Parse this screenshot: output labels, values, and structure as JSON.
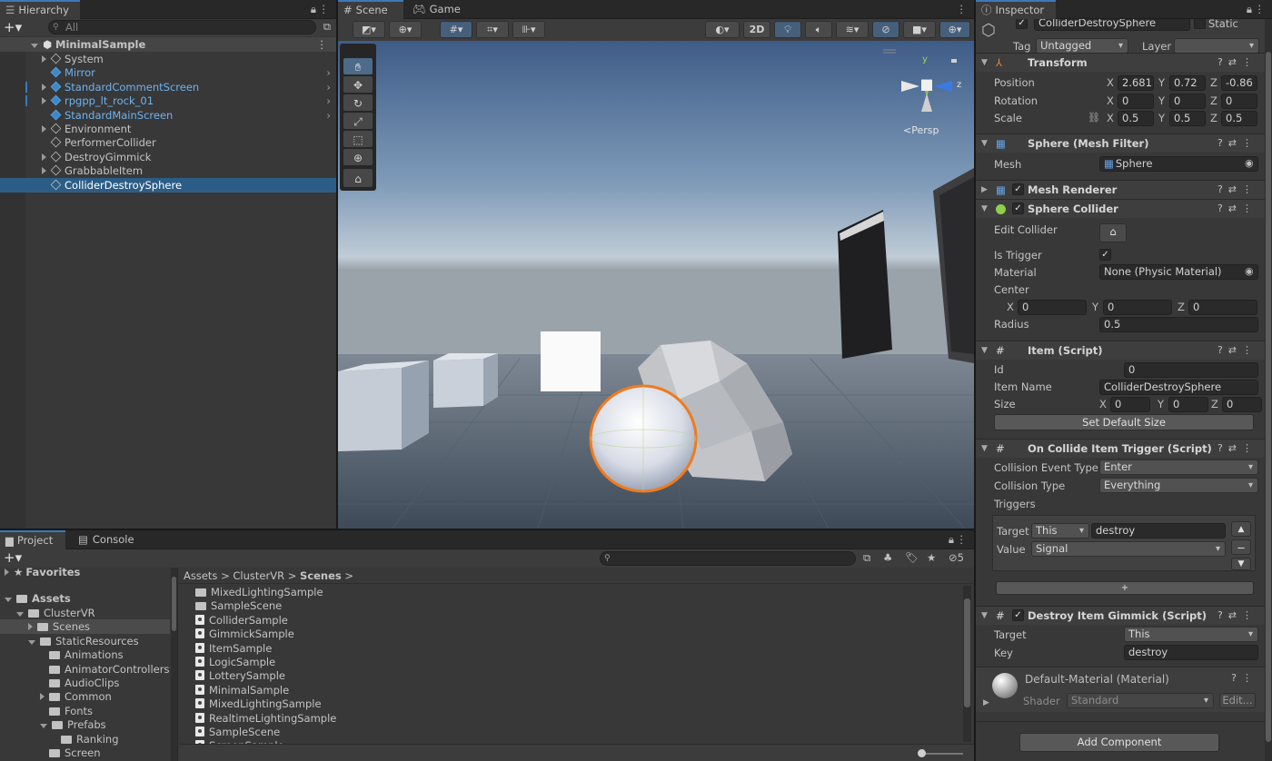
{
  "hierarchy": {
    "tab": "Hierarchy",
    "search_placeholder": "All",
    "root": "MinimalSample",
    "items": [
      {
        "label": "System",
        "blue": false,
        "expand": true,
        "arrow": false
      },
      {
        "label": "Mirror",
        "blue": true,
        "expand": false,
        "arrow": true
      },
      {
        "label": "StandardCommentScreen",
        "blue": true,
        "expand": true,
        "arrow": true
      },
      {
        "label": "rpgpp_lt_rock_01",
        "blue": true,
        "expand": true,
        "arrow": true
      },
      {
        "label": "StandardMainScreen",
        "blue": true,
        "expand": false,
        "arrow": true
      },
      {
        "label": "Environment",
        "blue": false,
        "expand": true,
        "arrow": false
      },
      {
        "label": "PerformerCollider",
        "blue": false,
        "expand": false,
        "arrow": false
      },
      {
        "label": "DestroyGimmick",
        "blue": false,
        "expand": true,
        "arrow": false
      },
      {
        "label": "GrabbableItem",
        "blue": false,
        "expand": true,
        "arrow": false
      },
      {
        "label": "ColliderDestroySphere",
        "blue": false,
        "expand": false,
        "arrow": false,
        "selected": true
      }
    ]
  },
  "scene": {
    "tab_scene": "Scene",
    "tab_game": "Game",
    "btn_2d": "2D",
    "persp": "Persp",
    "axis_y": "y",
    "axis_z": "z"
  },
  "project": {
    "tab_project": "Project",
    "tab_console": "Console",
    "favorites": "Favorites",
    "assets": "Assets",
    "hidden_count": "5",
    "breadcrumb": [
      "Assets",
      "ClusterVR",
      "Scenes"
    ],
    "tree": [
      {
        "label": "ClusterVR",
        "indent": 1,
        "open": true
      },
      {
        "label": "Scenes",
        "indent": 2,
        "open": false,
        "selected": true
      },
      {
        "label": "StaticResources",
        "indent": 2,
        "open": true
      },
      {
        "label": "Animations",
        "indent": 3,
        "open": false,
        "noarrow": true
      },
      {
        "label": "AnimatorControllers",
        "indent": 3,
        "open": false,
        "noarrow": true
      },
      {
        "label": "AudioClips",
        "indent": 3,
        "open": false,
        "noarrow": true
      },
      {
        "label": "Common",
        "indent": 3,
        "open": false
      },
      {
        "label": "Fonts",
        "indent": 3,
        "open": false,
        "noarrow": true
      },
      {
        "label": "Prefabs",
        "indent": 3,
        "open": true
      },
      {
        "label": "Ranking",
        "indent": 4,
        "open": false,
        "noarrow": true
      },
      {
        "label": "Screen",
        "indent": 3,
        "open": false,
        "noarrow": true
      }
    ],
    "files": [
      {
        "label": "MixedLightingSample",
        "type": "folder"
      },
      {
        "label": "SampleScene",
        "type": "folder"
      },
      {
        "label": "ColliderSample",
        "type": "scene"
      },
      {
        "label": "GimmickSample",
        "type": "scene"
      },
      {
        "label": "ItemSample",
        "type": "scene"
      },
      {
        "label": "LogicSample",
        "type": "scene"
      },
      {
        "label": "LotterySample",
        "type": "scene"
      },
      {
        "label": "MinimalSample",
        "type": "scene"
      },
      {
        "label": "MixedLightingSample",
        "type": "scene"
      },
      {
        "label": "RealtimeLightingSample",
        "type": "scene"
      },
      {
        "label": "SampleScene",
        "type": "scene"
      },
      {
        "label": "ScreenSample",
        "type": "scene"
      }
    ]
  },
  "inspector": {
    "tab": "Inspector",
    "object_name": "ColliderDestroySphere",
    "static_label": "Static",
    "tag_label": "Tag",
    "tag_value": "Untagged",
    "layer_label": "Layer",
    "layer_value": "",
    "transform": {
      "title": "Transform",
      "position_label": "Position",
      "rotation_label": "Rotation",
      "scale_label": "Scale",
      "position": [
        "2.681",
        "0.72",
        "-0.86"
      ],
      "rotation": [
        "0",
        "0",
        "0"
      ],
      "scale": [
        "0.5",
        "0.5",
        "0.5"
      ]
    },
    "mesh_filter": {
      "title": "Sphere (Mesh Filter)",
      "mesh_label": "Mesh",
      "mesh_value": "Sphere"
    },
    "mesh_renderer": {
      "title": "Mesh Renderer"
    },
    "sphere_collider": {
      "title": "Sphere Collider",
      "edit_label": "Edit Collider",
      "trigger_label": "Is Trigger",
      "material_label": "Material",
      "material_value": "None (Physic Material)",
      "center_label": "Center",
      "center": [
        "0",
        "0",
        "0"
      ],
      "radius_label": "Radius",
      "radius_value": "0.5"
    },
    "item_script": {
      "title": "Item (Script)",
      "id_label": "Id",
      "id_value": "0",
      "name_label": "Item Name",
      "name_value": "ColliderDestroySphere",
      "size_label": "Size",
      "size": [
        "0",
        "0",
        "0"
      ],
      "default_btn": "Set Default Size"
    },
    "trigger_script": {
      "title": "On Collide Item Trigger (Script)",
      "event_label": "Collision Event Type",
      "event_value": "Enter",
      "ctype_label": "Collision Type",
      "ctype_value": "Everything",
      "triggers_label": "Triggers",
      "target_label": "Target",
      "target_value": "This",
      "target_key": "destroy",
      "value_label": "Value",
      "value_value": "Signal",
      "add_btn": "+"
    },
    "gimmick_script": {
      "title": "Destroy Item Gimmick (Script)",
      "target_label": "Target",
      "target_value": "This",
      "key_label": "Key",
      "key_value": "destroy"
    },
    "material": {
      "name": "Default-Material (Material)",
      "shader_label": "Shader",
      "shader_value": "Standard",
      "edit_btn": "Edit..."
    },
    "add_component": "Add Component"
  },
  "colors": {
    "accent": "#3a79bb",
    "selection": "#2c5d87",
    "sphere_outline": "#f07a1e"
  }
}
